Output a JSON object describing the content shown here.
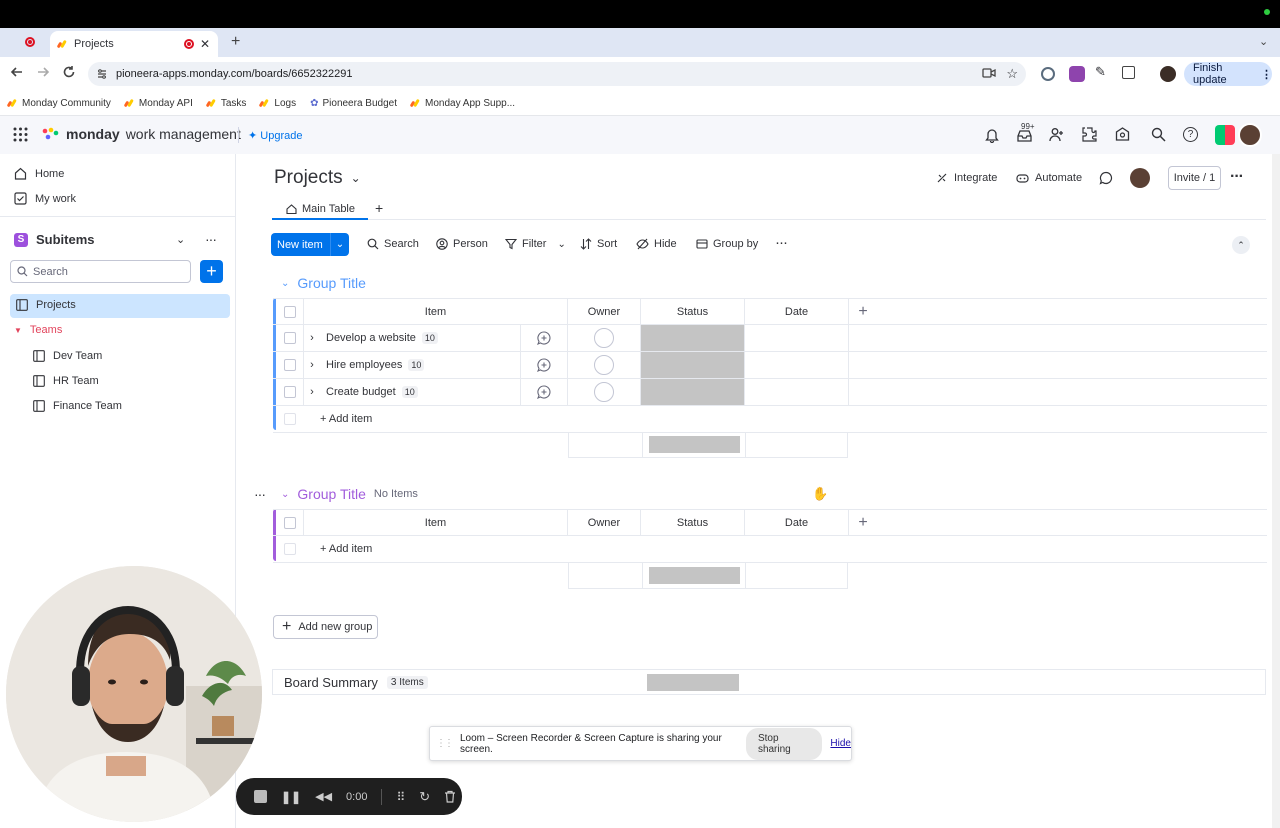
{
  "browser": {
    "tab_title": "Projects",
    "url": "pioneera-apps.monday.com/boards/6652322291",
    "finish_update": "Finish update",
    "bookmarks": [
      {
        "label": "Monday Community"
      },
      {
        "label": "Monday API"
      },
      {
        "label": "Tasks"
      },
      {
        "label": "Logs"
      },
      {
        "label": "Pioneera Budget"
      },
      {
        "label": "Monday App Supp..."
      }
    ]
  },
  "app": {
    "brand_bold": "monday",
    "brand_rest": "work management",
    "upgrade": "Upgrade",
    "notif_badge": "99+"
  },
  "sidebar": {
    "home": "Home",
    "my_work": "My work",
    "workspace_initial": "S",
    "workspace": "Subitems",
    "search_placeholder": "Search",
    "projects": "Projects",
    "teams_folder": "Teams",
    "teams": [
      {
        "label": "Dev Team"
      },
      {
        "label": "HR Team"
      },
      {
        "label": "Finance Team"
      }
    ]
  },
  "board": {
    "title": "Projects",
    "integrate": "Integrate",
    "automate": "Automate",
    "invite": "Invite / 1",
    "main_tab": "Main Table",
    "new_item": "New item",
    "toolbar": {
      "search": "Search",
      "person": "Person",
      "filter": "Filter",
      "sort": "Sort",
      "hide": "Hide",
      "group_by": "Group by"
    },
    "columns": {
      "item": "Item",
      "owner": "Owner",
      "status": "Status",
      "date": "Date"
    },
    "groups": [
      {
        "title": "Group Title",
        "color": "#579bfc",
        "items": [
          {
            "name": "Develop a website",
            "count": "10"
          },
          {
            "name": "Hire employees",
            "count": "10"
          },
          {
            "name": "Create budget",
            "count": "10"
          }
        ],
        "add_item": "+ Add item"
      },
      {
        "title": "Group Title",
        "color": "#a25ddc",
        "subtitle": "No Items",
        "items": [],
        "add_item": "+ Add item"
      }
    ],
    "add_new_group": "Add new group",
    "summary_title": "Board Summary",
    "summary_count": "3 Items"
  },
  "loom": {
    "message": "Loom – Screen Recorder & Screen Capture is sharing your screen.",
    "stop_sharing": "Stop sharing",
    "hide": "Hide",
    "timer": "0:00"
  }
}
